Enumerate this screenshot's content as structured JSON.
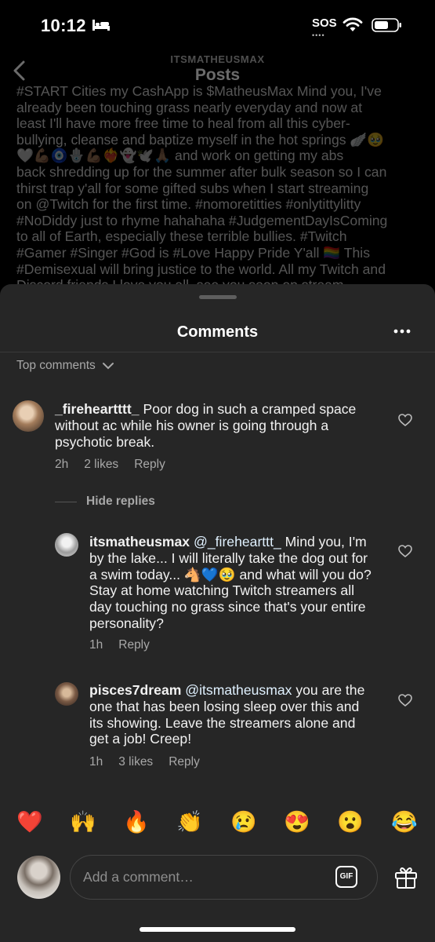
{
  "status_bar": {
    "time": "10:12",
    "sos": "SOS",
    "sos_dots": "••••",
    "icons": [
      "bed-icon",
      "wifi-icon",
      "battery-icon"
    ]
  },
  "header": {
    "username": "ITSMATHEUSMAX",
    "title": "Posts",
    "back_icon": "chevron-left-icon"
  },
  "caption_lines": [
    "#START  Cities my CashApp is $MatheusMax Mind you, I've",
    "already been touching grass nearly everyday and now at",
    "least I'll have more free time to heal from all this cyber-",
    "bullying, cleanse and baptize myself in the hot springs 🪽🥹",
    "🤍💪🏽🧿🪬💪🏽❤️‍🔥👻🕊️🙏🏽 and work on getting my abs",
    "back shredding up for the summer after bulk season so I can",
    "thirst trap y'all for some gifted subs when I start streaming",
    "on @Twitch for the first time. #nomoretitties #onlytittylitty",
    "#NoDiddy just to rhyme hahahaha #JudgementDayIsComing",
    "to all of Earth, especially these terrible bullies. #Twitch",
    "#Gamer #Singer #God is #Love  Happy Pride Y'all 🏳️‍🌈 This",
    "#Demisexual will bring justice to the world. All my Twitch and",
    "Discord friends I love you all, see you soon on stream"
  ],
  "sheet": {
    "title": "Comments",
    "sort_label": "Top comments",
    "hide_replies": "Hide replies"
  },
  "comments": [
    {
      "username": "_fireheartttt_",
      "text": "Poor dog in such a cramped space without ac while his owner is going through a psychotic break.",
      "time": "2h",
      "likes": "2 likes",
      "reply": "Reply"
    }
  ],
  "replies": [
    {
      "username": "itsmatheusmax",
      "mention": "@_firehearttt_",
      "text": "Mind you, I'm by the lake... I will literally take the dog out for a swim today... 🐴💙🥹 and what will you do? Stay at home watching Twitch streamers all day touching no grass since that's your entire personality?",
      "time": "1h",
      "likes": "",
      "reply": "Reply"
    },
    {
      "username": "pisces7dream",
      "mention": "@itsmatheusmax",
      "text": "you are the one that has been losing sleep over this and its showing. Leave the streamers alone and get a job! Creep!",
      "time": "1h",
      "likes": "3 likes",
      "reply": "Reply"
    }
  ],
  "reactions": [
    "❤️",
    "🙌",
    "🔥",
    "👏",
    "😢",
    "😍",
    "😮",
    "😂"
  ],
  "composer": {
    "placeholder": "Add a comment…",
    "gif_label": "GIF"
  },
  "colors": {
    "sheet_bg": "#262626",
    "secondary_text": "#a8a8a8",
    "mention": "#e0f1ff"
  }
}
